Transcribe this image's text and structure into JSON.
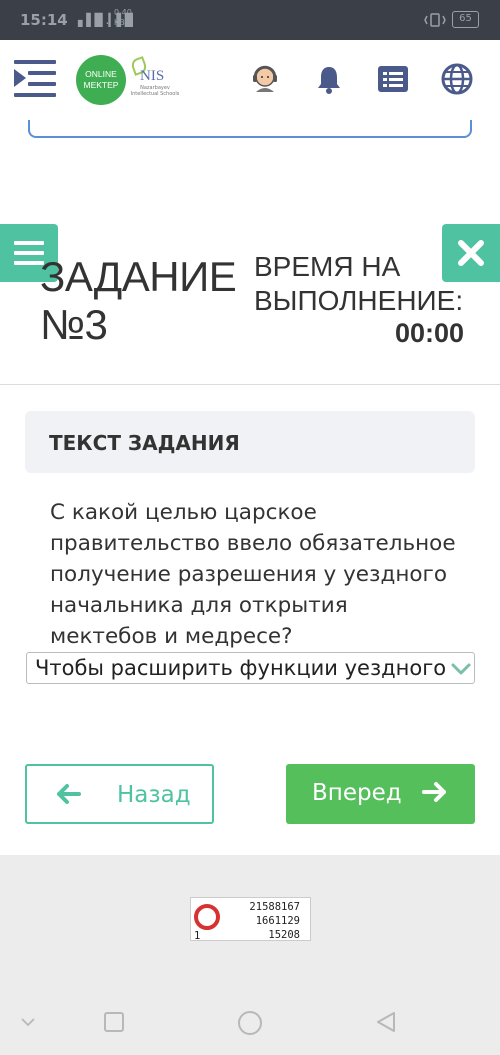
{
  "status_bar": {
    "time": "15:14",
    "signal": "▖▌▉ .▎▌▉",
    "speed_value": "0.40",
    "speed_unit": "KB/S",
    "battery": "65"
  },
  "header": {
    "logo_text_line1": "ONLINE",
    "logo_text_line2": "MEKTEP",
    "nis_title": "NIS",
    "nis_subtitle": "Nazarbayev Intellectual Schools"
  },
  "task": {
    "title_line1": "ЗАДАНИЕ",
    "title_line2": "№3",
    "timer_label_line1": "ВРЕМЯ НА",
    "timer_label_line2": "ВЫПОЛНЕНИЕ:",
    "timer_value": "00:00",
    "section_header": "ТЕКСТ ЗАДАНИЯ",
    "question_lines": [
      "С какой целью царское",
      "правительство ввело обязательное",
      "получение разрешения у уездного",
      "начальника для открытия",
      "мектебов и медресе?"
    ],
    "selected_answer": "Чтобы расширить функции уездного"
  },
  "navigation": {
    "back_label": "Назад",
    "next_label": "Вперед"
  },
  "stamp": {
    "line1": "21588167",
    "line2": "1661129",
    "line3_left": "1",
    "line3_right": "15208"
  },
  "colors": {
    "accent_teal": "#4fc3a1",
    "accent_green": "#55bf5c",
    "brand_green": "#3fae52",
    "nav_blue": "#4a5a8a",
    "status_bar_bg": "#3a3f48"
  }
}
